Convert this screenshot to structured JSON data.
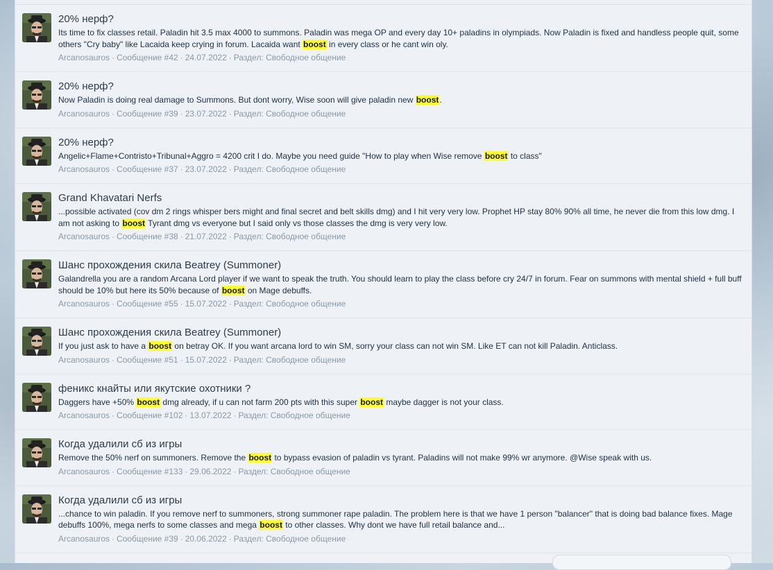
{
  "results": [
    {
      "title": "20% нерф?",
      "snippet": [
        {
          "t": "Its time to fix classes retail. Paladin hit 3.5 max 4000 to summons. Paladin was mega OP and every day 10+ paladins in olympiads. Now Paladin is fixed and handless people quit, some others \"Cry baby\" like Lacaida keep crying in forum. Lacaida want "
        },
        {
          "t": "boost",
          "hl": true
        },
        {
          "t": " in every class or he cant win oly."
        }
      ],
      "author": "Arcanosauros",
      "post": "Сообщение #42",
      "date": "24.07.2022",
      "section": "Раздел: Свободное общение"
    },
    {
      "title": "20% нерф?",
      "snippet": [
        {
          "t": "Now Paladin is doing real damage to Summons. But dont worry, Wise soon will give paladin new "
        },
        {
          "t": "boost",
          "hl": true
        },
        {
          "t": "."
        }
      ],
      "author": "Arcanosauros",
      "post": "Сообщение #39",
      "date": "23.07.2022",
      "section": "Раздел: Свободное общение"
    },
    {
      "title": "20% нерф?",
      "snippet": [
        {
          "t": "Angelic+Flame+Contristo+Tribunal+Aggro = 4200 crit I do. Maybe you need guide \"How to play when Wise remove "
        },
        {
          "t": "boost",
          "hl": true
        },
        {
          "t": " to class\""
        }
      ],
      "author": "Arcanosauros",
      "post": "Сообщение #37",
      "date": "23.07.2022",
      "section": "Раздел: Свободное общение"
    },
    {
      "title": "Grand Khavatari Nerfs",
      "snippet": [
        {
          "t": "...possible activated (cov dm 2 rings whisper bers might and final secret and belt skills dmg) and I hit very very low. Prophet HP stay 80% 90% all time, he never die from this low dmg. I am not asking to "
        },
        {
          "t": "boost",
          "hl": true
        },
        {
          "t": " Tyrant dmg vs everyone but I said only vs those classes the dmg is very very low."
        }
      ],
      "author": "Arcanosauros",
      "post": "Сообщение #38",
      "date": "21.07.2022",
      "section": "Раздел: Свободное общение"
    },
    {
      "title": "Шанс прохождения скила Beatrey (Summoner)",
      "snippet": [
        {
          "t": "Galandrella you are a random Arcana Lord player if we want to speak the truth. You should learn to play the class before cry 24/7 in forum. Fear on summons with mental shield + full buff should be 10% but here its 50% because of "
        },
        {
          "t": "boost",
          "hl": true
        },
        {
          "t": " on Mage debuffs."
        }
      ],
      "author": "Arcanosauros",
      "post": "Сообщение #55",
      "date": "15.07.2022",
      "section": "Раздел: Свободное общение"
    },
    {
      "title": "Шанс прохождения скила Beatrey (Summoner)",
      "snippet": [
        {
          "t": "If you just ask to have a "
        },
        {
          "t": "boost",
          "hl": true
        },
        {
          "t": " on betray OK. If you want arcana lord to win SM, sorry your class can not win SM. Like ET can not kill Paladin. Anticlass."
        }
      ],
      "author": "Arcanosauros",
      "post": "Сообщение #51",
      "date": "15.07.2022",
      "section": "Раздел: Свободное общение"
    },
    {
      "title": "феникс кнайты или якутские охотники ?",
      "snippet": [
        {
          "t": "Daggers have +50% "
        },
        {
          "t": "boost",
          "hl": true
        },
        {
          "t": " dmg already, if u can not farm 200 pts with this super "
        },
        {
          "t": "boost",
          "hl": true
        },
        {
          "t": " maybe dagger is not your class."
        }
      ],
      "author": "Arcanosauros",
      "post": "Сообщение #102",
      "date": "13.07.2022",
      "section": "Раздел: Свободное общение"
    },
    {
      "title": "Когда удалили сб из игры",
      "snippet": [
        {
          "t": "Remove the 50% nerf on summoners. Remove the "
        },
        {
          "t": "boost",
          "hl": true
        },
        {
          "t": " to bypass evasion of paladin vs tyrant. Paladins will not make 99% wr anymore. @Wise speak with us."
        }
      ],
      "author": "Arcanosauros",
      "post": "Сообщение #133",
      "date": "29.06.2022",
      "section": "Раздел: Свободное общение"
    },
    {
      "title": "Когда удалили сб из игры",
      "snippet": [
        {
          "t": "...chance to win paladin. If you remove nerf to summoners, strong summoner rape paladin. The problem here is that we have 1 person \"balancer\" that is doing bad balance fixes. Mage debuffs 100%, mega nerfs to some classes and mega "
        },
        {
          "t": "boost",
          "hl": true
        },
        {
          "t": " to other classes. Why dont we have full retail balance and..."
        }
      ],
      "author": "Arcanosauros",
      "post": "Сообщение #39",
      "date": "20.06.2022",
      "section": "Раздел: Свободное общение"
    }
  ],
  "meta_separator": "·"
}
